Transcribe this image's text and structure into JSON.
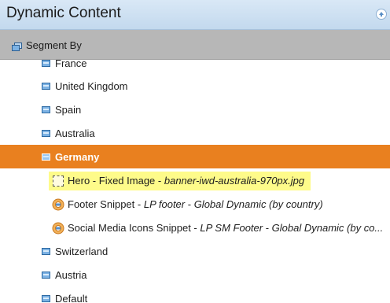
{
  "header": {
    "title": "Dynamic Content",
    "collapse_icon": "collapse-up-icon"
  },
  "segment_bar": {
    "label": "Segment By",
    "icon": "segment-icon"
  },
  "tree": {
    "rows_before": [
      {
        "label": "France"
      },
      {
        "label": "United Kingdom"
      },
      {
        "label": "Spain"
      },
      {
        "label": "Australia"
      }
    ],
    "selected": {
      "label": "Germany"
    },
    "items": [
      {
        "name": "Hero",
        "sep": " - ",
        "type": "Fixed Image",
        "sep2": " - ",
        "value": "banner-iwd-australia-970px.jpg",
        "highlighted": true,
        "icon": "fixed-image-icon"
      },
      {
        "name": "Footer Snippet",
        "sep": " - ",
        "type": "LP footer",
        "sep2": " - ",
        "value": "Global Dynamic (by country)",
        "highlighted": false,
        "icon": "snippet-icon"
      },
      {
        "name": "Social Media Icons Snippet",
        "sep": " - ",
        "type": "LP SM Footer",
        "sep2": " - ",
        "value": "Global Dynamic (by co...",
        "highlighted": false,
        "icon": "snippet-icon"
      }
    ],
    "rows_after": [
      {
        "label": "Switzerland"
      },
      {
        "label": "Austria"
      },
      {
        "label": "Default"
      }
    ]
  },
  "colors": {
    "selected_row": "#e9801f",
    "highlight": "#fefb8a",
    "header_bg": "#c3d9ee",
    "segment_bar_bg": "#b7b7b7"
  }
}
